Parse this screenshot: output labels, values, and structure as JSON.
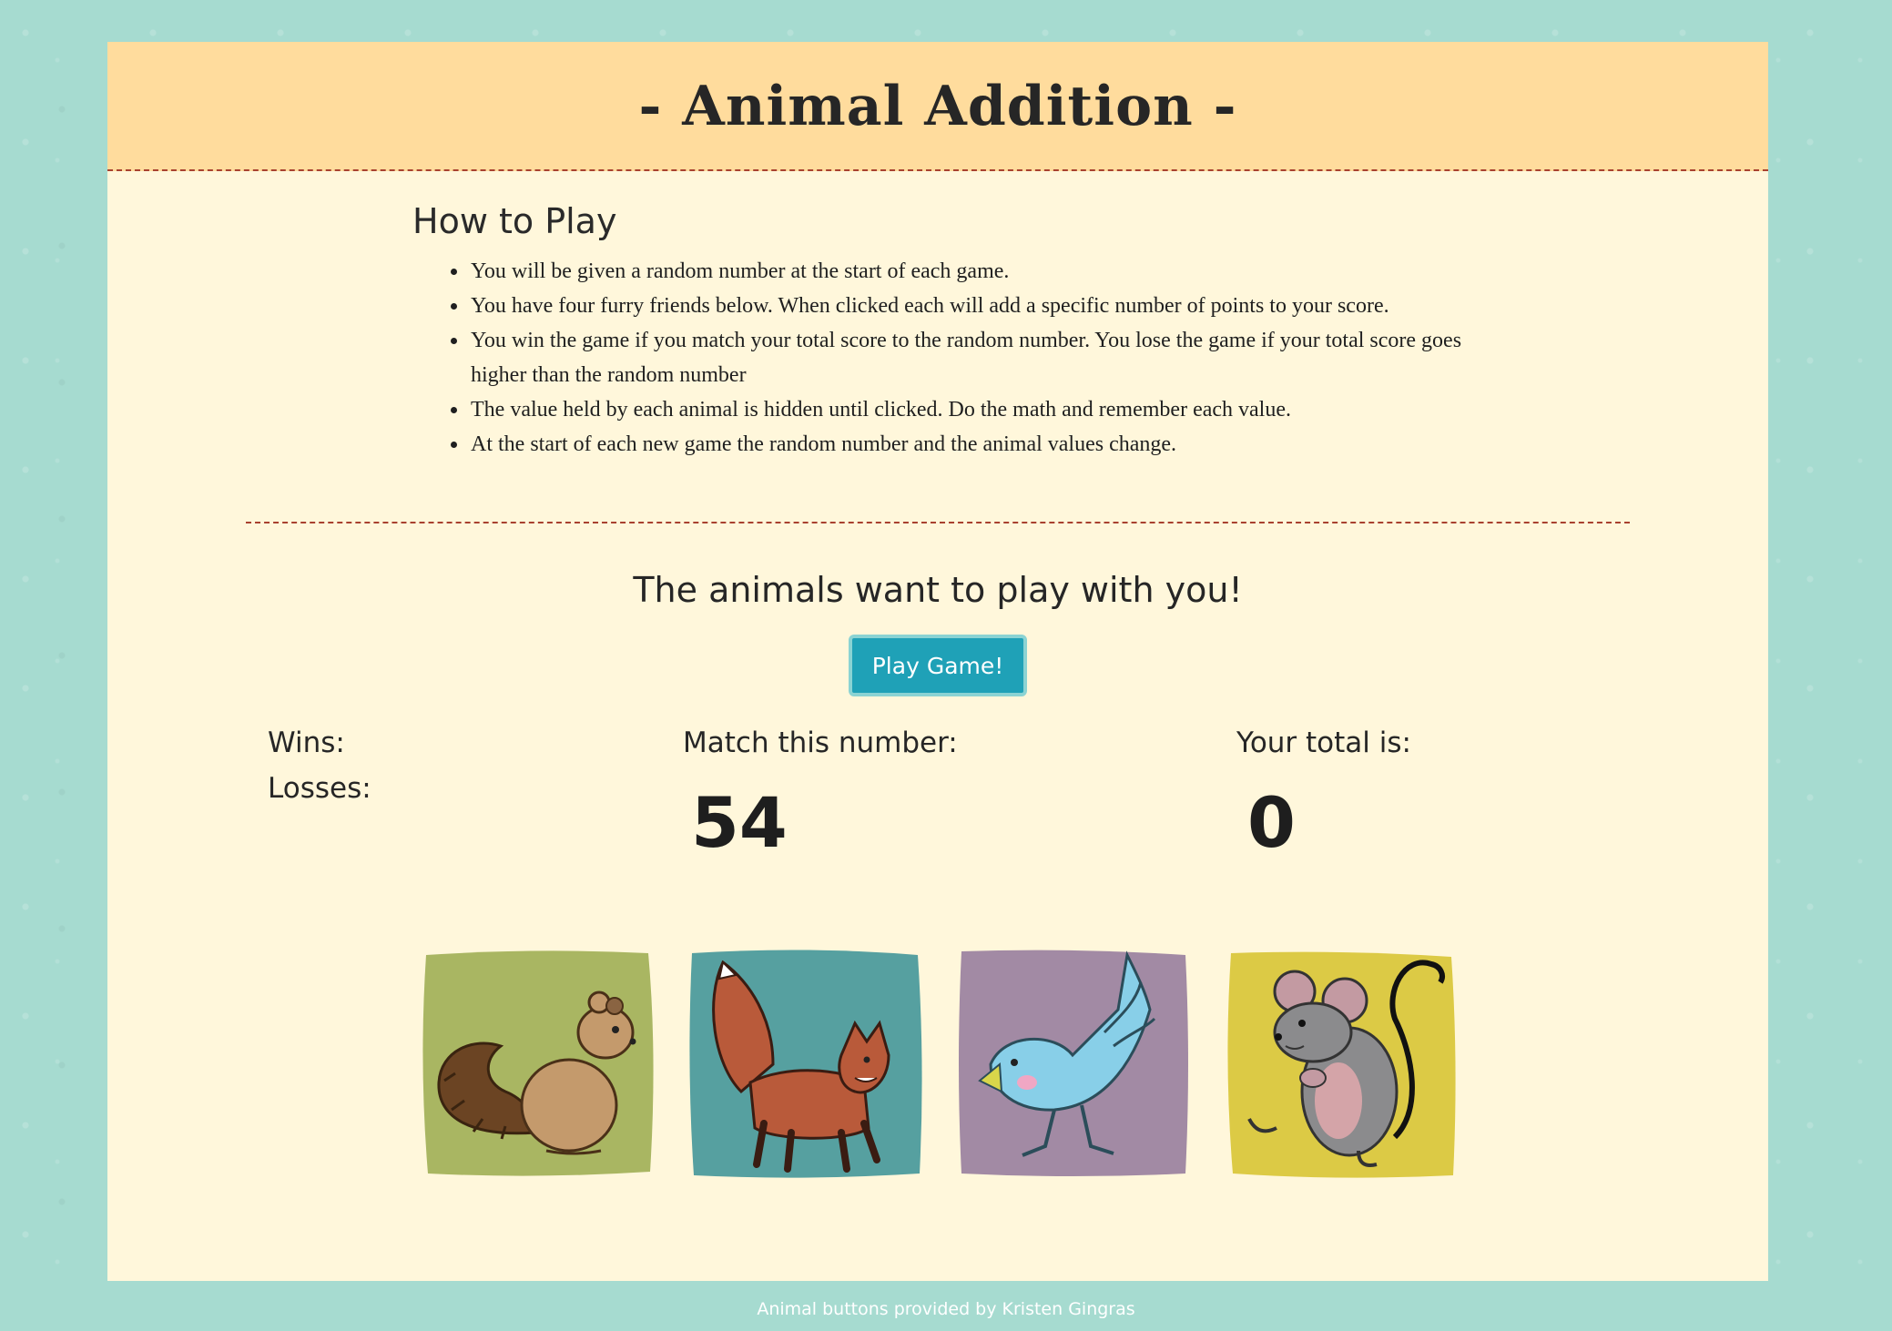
{
  "header": {
    "title": "- Animal Addition -"
  },
  "instructions": {
    "heading": "How to Play",
    "rules": [
      "You will be given a random number at the start of each game.",
      "You have four furry friends below. When clicked each will add a specific number of points to your score.",
      "You win the game if you match your total score to the random number. You lose the game if your total score goes higher than the random number",
      "The value held by each animal is hidden until clicked. Do the math and remember each value.",
      "At the start of each new game the random number and the animal values change."
    ]
  },
  "game": {
    "invite": "The animals want to play with you!",
    "play_button": "Play Game!",
    "wins_label": "Wins:",
    "losses_label": "Losses:",
    "target_label": "Match this number:",
    "target_value": "54",
    "total_label": "Your total is:",
    "total_value": "0"
  },
  "animals": [
    {
      "name": "squirrel",
      "background": "#a9b662"
    },
    {
      "name": "fox",
      "background": "#56a0a0"
    },
    {
      "name": "bird",
      "background": "#a28aa4"
    },
    {
      "name": "mouse",
      "background": "#dcca45"
    }
  ],
  "footer": {
    "credit": "Animal buttons provided by Kristen Gingras"
  },
  "colors": {
    "page_background": "#a6dbd0",
    "panel": "#fff7db",
    "header": "#ffdc9d",
    "divider": "#a8412f",
    "button": "#1fa1b7"
  }
}
